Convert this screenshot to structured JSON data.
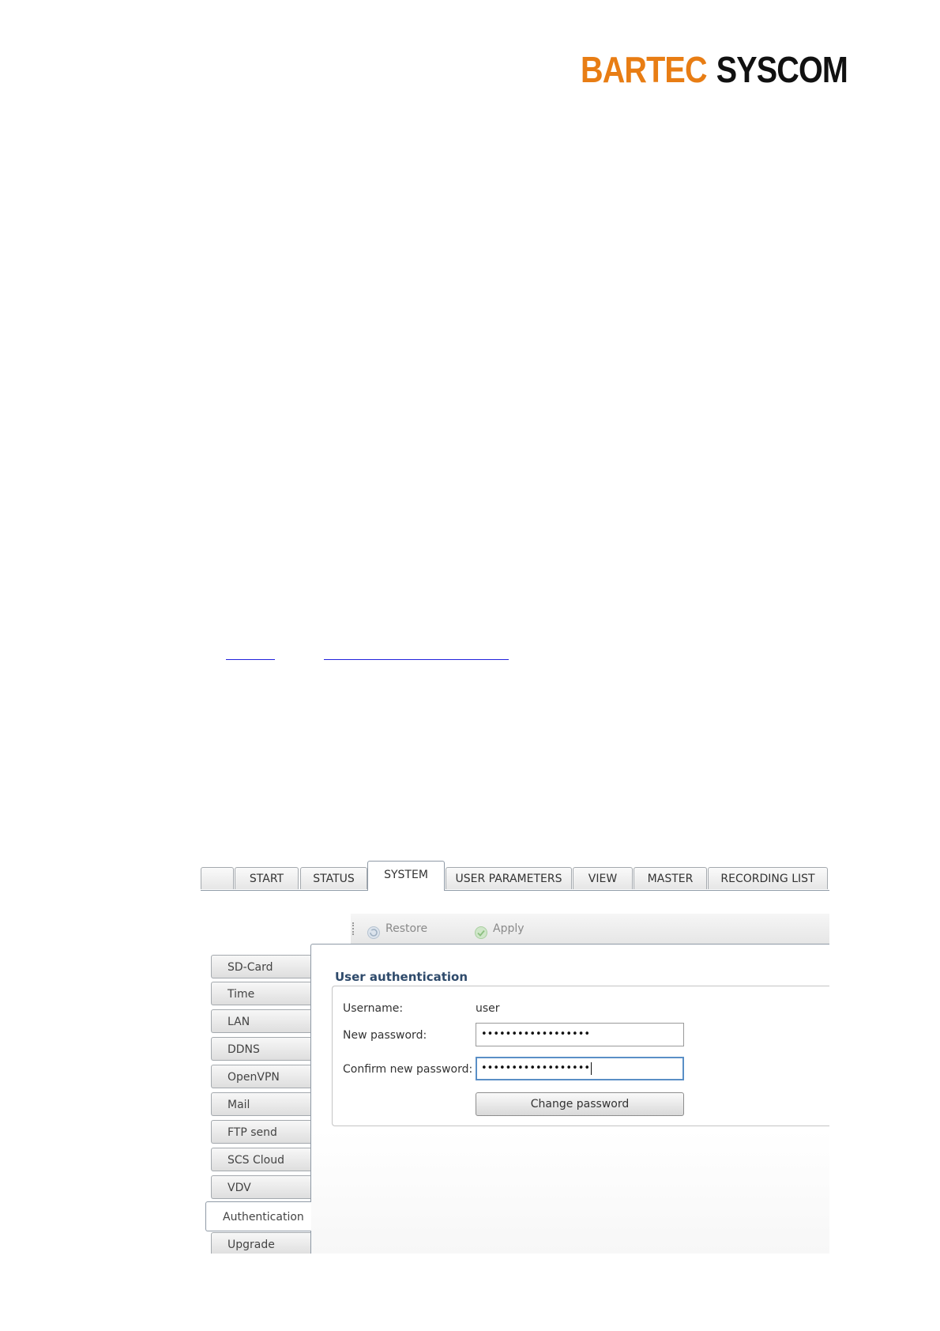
{
  "logo": {
    "part1": "BARTEC",
    "part2": "SYSCOM"
  },
  "tabs": [
    "",
    "START",
    "STATUS",
    "SYSTEM",
    "USER PARAMETERS",
    "VIEW",
    "MASTER",
    "RECORDING LIST"
  ],
  "active_tab": "SYSTEM",
  "toolbar": {
    "restore_label": "Restore",
    "apply_label": "Apply"
  },
  "sidebar": {
    "items": [
      "SD-Card",
      "Time",
      "LAN",
      "DDNS",
      "OpenVPN",
      "Mail",
      "FTP send",
      "SCS Cloud",
      "VDV",
      "Authentication",
      "Upgrade"
    ],
    "active": "Authentication"
  },
  "form": {
    "title": "User authentication",
    "username_label": "Username:",
    "username_value": "user",
    "new_password_label": "New password:",
    "new_password_value": "••••••••••••••••••",
    "confirm_password_label": "Confirm new password:",
    "confirm_password_value": "••••••••••••••••••",
    "change_button": "Change password"
  },
  "colors": {
    "brand_orange": "#E87D14",
    "brand_black": "#111111",
    "title_blue": "#2e4a6b"
  }
}
